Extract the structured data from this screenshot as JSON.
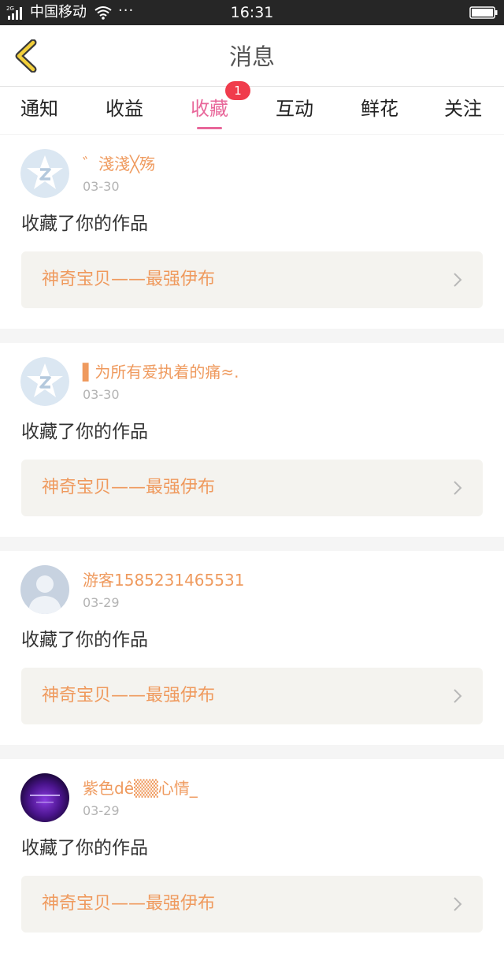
{
  "status_bar": {
    "carrier": "中国移动",
    "dots": "···",
    "time": "16:31"
  },
  "header": {
    "title": "消息"
  },
  "tabs": [
    {
      "label": "通知"
    },
    {
      "label": "收益"
    },
    {
      "label": "收藏",
      "active": true,
      "badge": "1"
    },
    {
      "label": "互动"
    },
    {
      "label": "鲜花"
    },
    {
      "label": "关注"
    }
  ],
  "colors": {
    "accent": "#e8679a",
    "badge": "#f03c4c",
    "username": "#ef9a5e",
    "work_title": "#ef9a5e"
  },
  "messages": [
    {
      "username": "゛淺淺╳殇",
      "date": "03-30",
      "action": "收藏了你的作品",
      "work": "神奇宝贝——最强伊布",
      "avatar": "qq-default-icon"
    },
    {
      "username": "▌为所有爱执着的痛≈.",
      "date": "03-30",
      "action": "收藏了你的作品",
      "work": "神奇宝贝——最强伊布",
      "avatar": "qq-default-icon"
    },
    {
      "username": "游客1585231465531",
      "date": "03-29",
      "action": "收藏了你的作品",
      "work": "神奇宝贝——最强伊布",
      "avatar": "guest-silhouette-icon"
    },
    {
      "username": "紫色dê▒▒心情_",
      "date": "03-29",
      "action": "收藏了你的作品",
      "work": "神奇宝贝——最强伊布",
      "avatar": "purple-photo-avatar"
    }
  ]
}
